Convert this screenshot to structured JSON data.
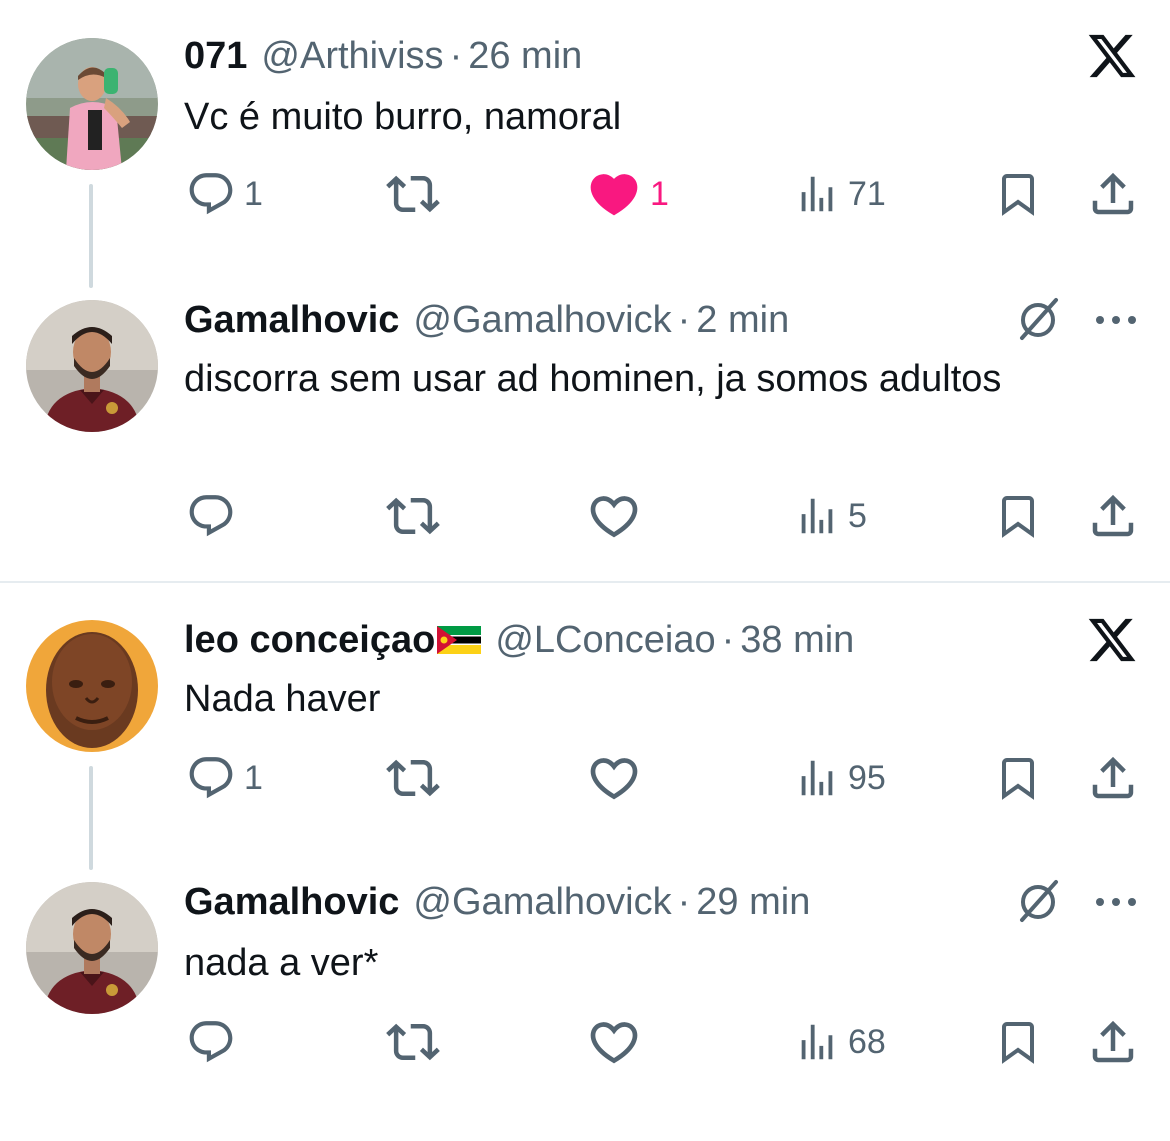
{
  "colors": {
    "text_primary": "#0f1419",
    "text_secondary": "#536471",
    "like_active": "#f91880",
    "thread_line": "#cfd9de",
    "divider": "#e6ecf0"
  },
  "icons": {
    "reply": "reply-icon",
    "retweet": "retweet-icon",
    "like": "heart-icon",
    "views": "views-icon",
    "bookmark": "bookmark-icon",
    "share": "share-icon",
    "platform": "x-logo-icon",
    "muted": "mute-icon",
    "more": "more-icon"
  },
  "tweets": [
    {
      "name": "071",
      "handle": "@Arthiviss",
      "separator": "·",
      "time": "26 min",
      "text": "Vc é muito burro, namoral",
      "replies": "1",
      "retweets": "",
      "likes": "1",
      "liked": true,
      "views": "71"
    },
    {
      "name": "Gamalhovic",
      "handle": "@Gamalhovick",
      "separator": "·",
      "time": "2 min",
      "text": "discorra sem usar ad hominen, ja somos adultos",
      "replies": "",
      "retweets": "",
      "likes": "",
      "liked": false,
      "views": "5"
    },
    {
      "name": "leo conceiçao",
      "flag": "Mozambique flag",
      "handle": "@LConceiao",
      "separator": "·",
      "time": "38 min",
      "text": "Nada haver",
      "replies": "1",
      "retweets": "",
      "likes": "",
      "liked": false,
      "views": "95"
    },
    {
      "name": "Gamalhovic",
      "handle": "@Gamalhovick",
      "separator": "·",
      "time": "29 min",
      "text": "nada a ver*",
      "replies": "",
      "retweets": "",
      "likes": "",
      "liked": false,
      "views": "68"
    }
  ]
}
